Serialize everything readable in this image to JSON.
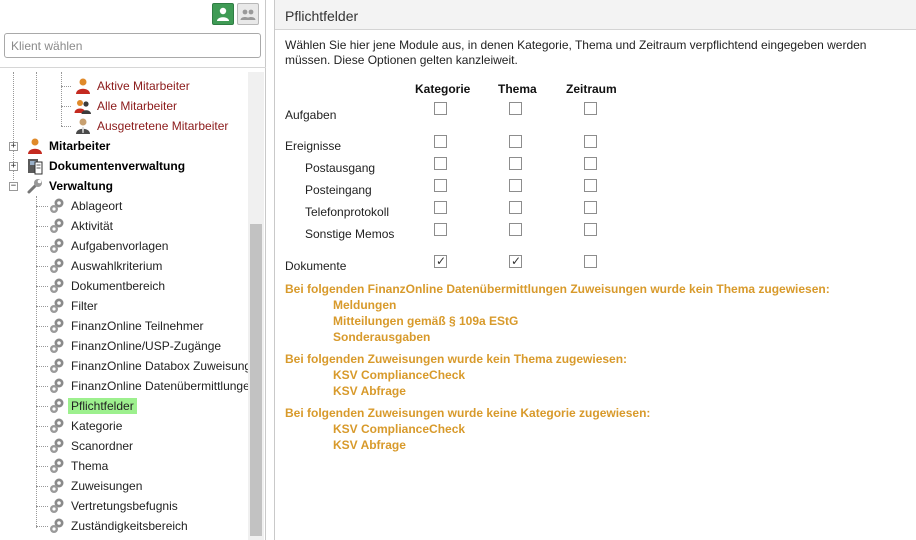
{
  "left": {
    "search_placeholder": "Klient wählen",
    "tree": {
      "aktive": "Aktive Mitarbeiter",
      "alle": "Alle Mitarbeiter",
      "ausgetretene": "Ausgetretene Mitarbeiter",
      "mitarbeiter": "Mitarbeiter",
      "dokumentenverwaltung": "Dokumentenverwaltung",
      "verwaltung": "Verwaltung",
      "items": [
        "Ablageort",
        "Aktivität",
        "Aufgabenvorlagen",
        "Auswahlkriterium",
        "Dokumentbereich",
        "Filter",
        "FinanzOnline Teilnehmer",
        "FinanzOnline/USP-Zugänge",
        "FinanzOnline Databox Zuweisunge",
        "FinanzOnline Datenübermittlungen",
        "Pflichtfelder",
        "Kategorie",
        "Scanordner",
        "Thema",
        "Zuweisungen",
        "Vertretungsbefugnis",
        "Zuständigkeitsbereich"
      ]
    }
  },
  "right": {
    "title": "Pflichtfelder",
    "description": "Wählen Sie hier jene Module aus, in denen Kategorie, Thema und Zeitraum verpflichtend eingegeben werden müssen. Diese Optionen gelten kanzleiweit.",
    "columns": [
      "Kategorie",
      "Thema",
      "Zeitraum"
    ],
    "rows": [
      {
        "label": "Aufgaben",
        "checked": [
          false,
          false,
          false
        ]
      },
      {
        "label": "Ereignisse",
        "checked": [
          false,
          false,
          false
        ]
      },
      {
        "label": "Postausgang",
        "checked": [
          false,
          false,
          false
        ]
      },
      {
        "label": "Posteingang",
        "checked": [
          false,
          false,
          false
        ]
      },
      {
        "label": "Telefonprotokoll",
        "checked": [
          false,
          false,
          false
        ]
      },
      {
        "label": "Sonstige Memos",
        "checked": [
          false,
          false,
          false
        ]
      },
      {
        "label": "Dokumente",
        "checked": [
          true,
          true,
          false
        ]
      }
    ],
    "warnings": [
      {
        "heading": "Bei folgenden FinanzOnline Datenübermittlungen Zuweisungen wurde kein Thema zugewiesen:",
        "items": [
          "Meldungen",
          "Mitteilungen gemäß § 109a EStG",
          "Sonderausgaben"
        ]
      },
      {
        "heading": "Bei folgenden Zuweisungen wurde kein Thema zugewiesen:",
        "items": [
          "KSV ComplianceCheck",
          "KSV Abfrage"
        ]
      },
      {
        "heading": "Bei folgenden Zuweisungen wurde keine Kategorie zugewiesen:",
        "items": [
          "KSV ComplianceCheck",
          "KSV Abfrage"
        ]
      }
    ],
    "warning_color": "#d89a2b"
  }
}
